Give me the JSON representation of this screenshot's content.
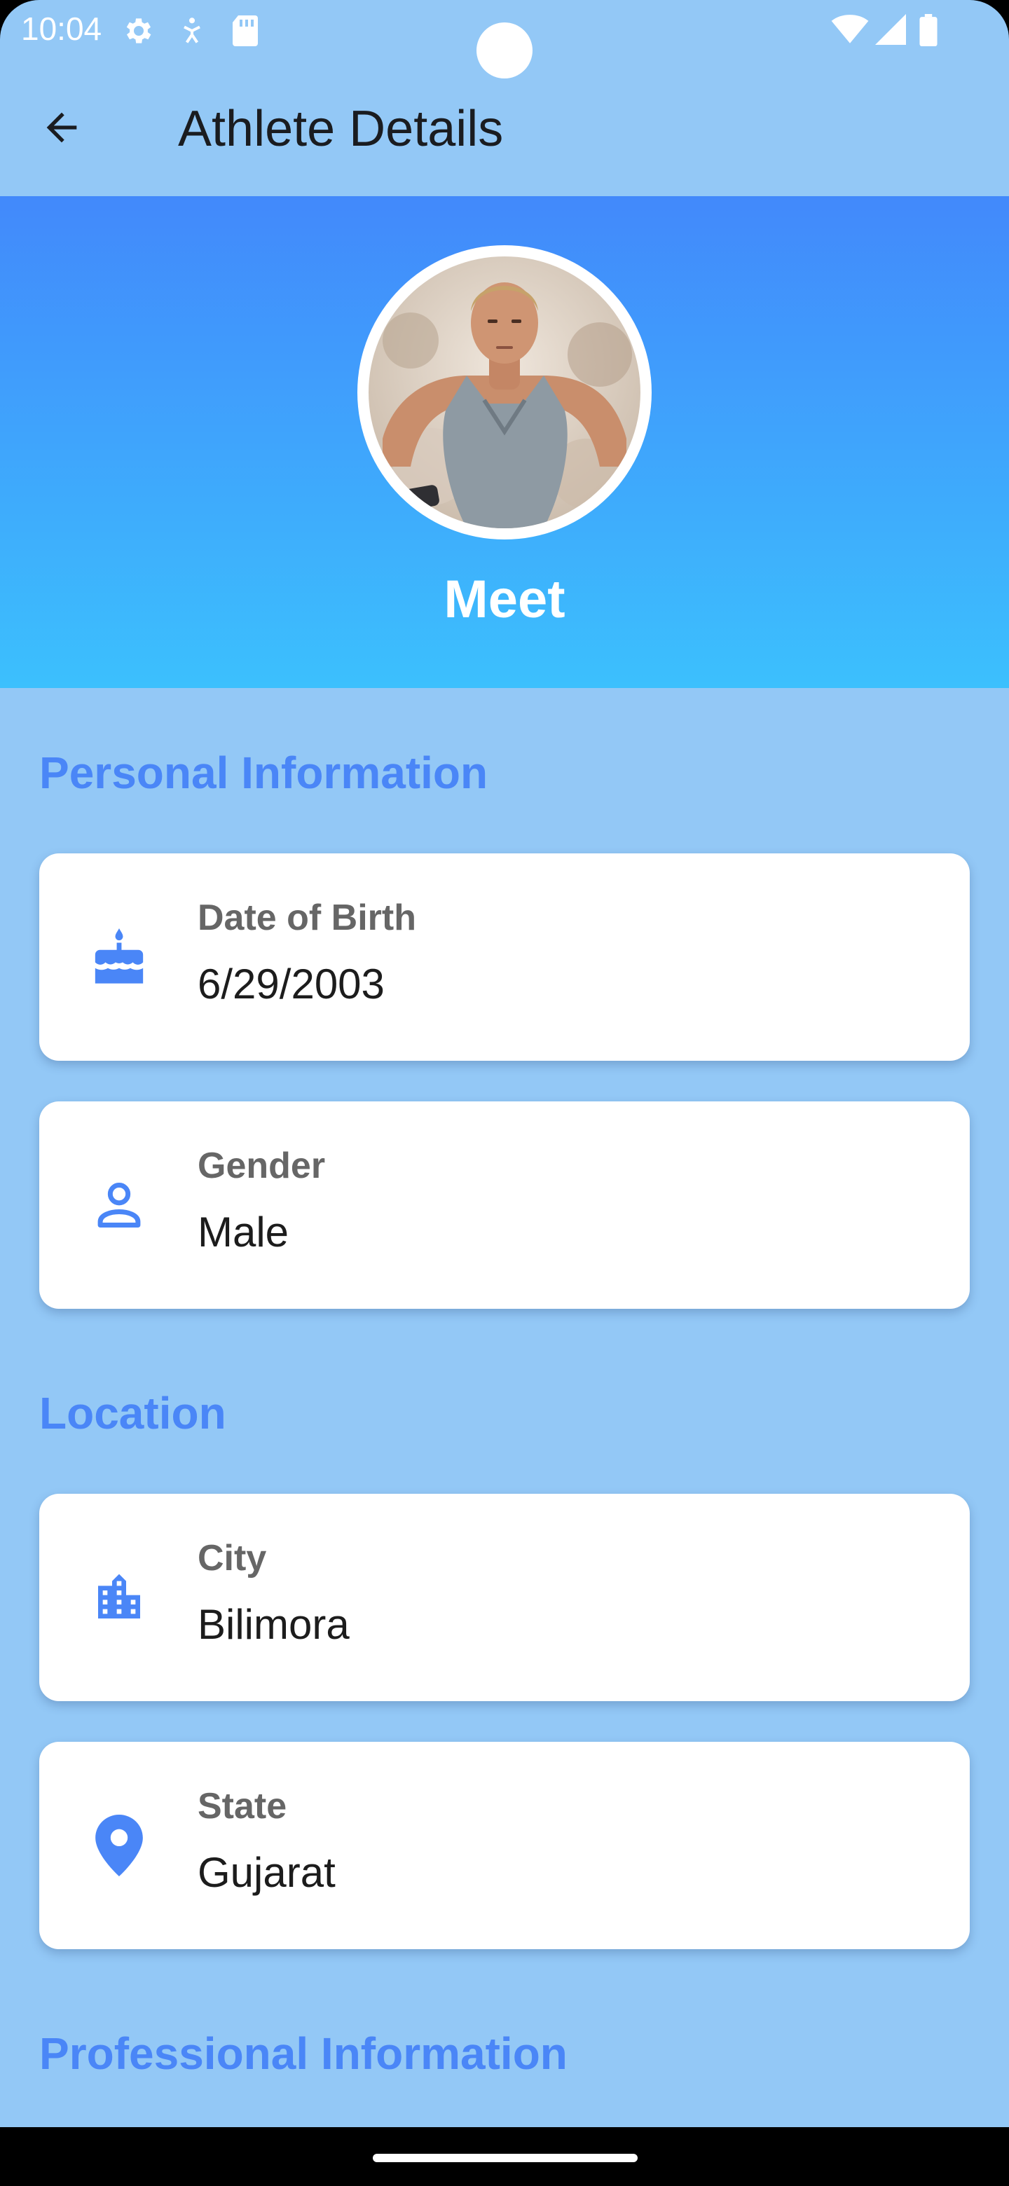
{
  "status_bar": {
    "time": "10:04"
  },
  "app_bar": {
    "title": "Athlete Details",
    "back_icon": "arrow-back-icon"
  },
  "profile": {
    "name": "Meet",
    "gradient_top": "#4289fb",
    "gradient_bottom": "#3cc0fd"
  },
  "sections": {
    "personal": {
      "title": "Personal Information",
      "items": [
        {
          "label": "Date of Birth",
          "value": "6/29/2003",
          "icon": "cake-icon"
        },
        {
          "label": "Gender",
          "value": "Male",
          "icon": "person-icon"
        }
      ]
    },
    "location": {
      "title": "Location",
      "items": [
        {
          "label": "City",
          "value": "Bilimora",
          "icon": "city-icon"
        },
        {
          "label": "State",
          "value": "Gujarat",
          "icon": "location-pin-icon"
        }
      ]
    },
    "professional": {
      "title": "Professional Information"
    }
  },
  "colors": {
    "background": "#93c8f6",
    "accent": "#4a86f7",
    "card": "#ffffff"
  }
}
